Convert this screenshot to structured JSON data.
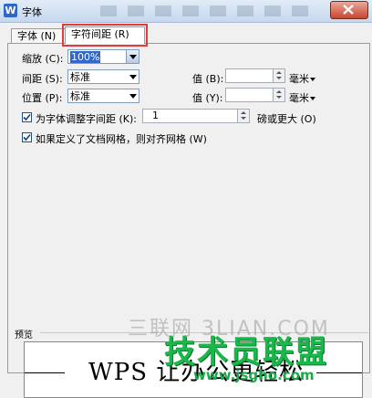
{
  "window": {
    "title": "字体",
    "logo": "W"
  },
  "tabs": [
    {
      "label": "字体 (N)"
    },
    {
      "label": "字符间距 (R)"
    }
  ],
  "scale": {
    "label": "缩放 (C):",
    "value": "100%"
  },
  "spacing": {
    "label": "间距 (S):",
    "value": "标准",
    "value_label": "值 (B):",
    "unit": "毫米"
  },
  "position": {
    "label": "位置 (P):",
    "value": "标准",
    "value_label": "值 (Y):",
    "unit": "毫米"
  },
  "kerning": {
    "label": "为字体调整字间距 (K):",
    "value": "1",
    "suffix": "磅或更大 (O)",
    "checked": true
  },
  "grid": {
    "label": "如果定义了文档网格，则对齐网格 (W)",
    "checked": true
  },
  "preview": {
    "label": "预览",
    "text": "WPS 让办公更轻松"
  },
  "watermark": {
    "line1": "三联网 3LIAN.COM",
    "line2": "技术员联盟",
    "line3": "www.jsgho.com"
  },
  "colors": {
    "accent": "#3168c9",
    "highlight": "#e23b3b",
    "watermark": "#19b84a"
  }
}
